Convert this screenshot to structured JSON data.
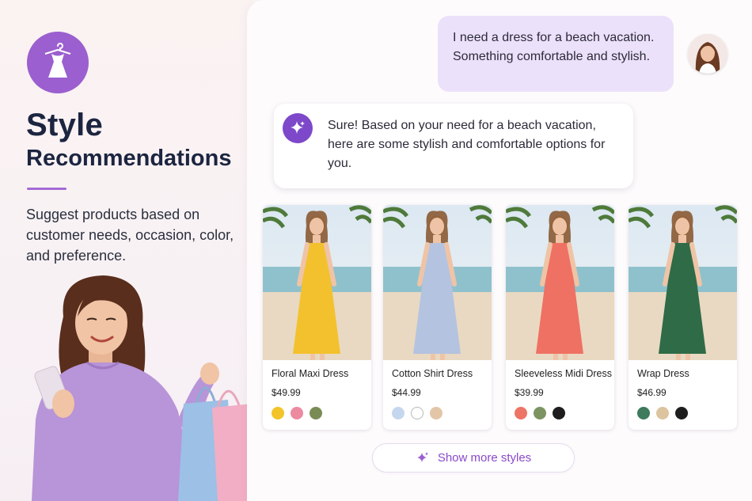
{
  "sidebar": {
    "logo_icon": "dress-hanger-icon",
    "title_line1": "Style",
    "title_line2": "Recommendations",
    "description": "Suggest products based on customer needs, occasion, color, and preference."
  },
  "chat": {
    "user_message": "I need a dress for a beach vacation. Something comfortable and stylish.",
    "assistant_icon": "sparkle-icon",
    "assistant_message": "Sure! Based on your need for a beach vacation, here are some stylish and comfortable options for you."
  },
  "products": [
    {
      "name": "Floral Maxi Dress",
      "price": "$49.99",
      "dress_color": "#f3c12e",
      "swatches": [
        "#f2c42a",
        "#ec8aa0",
        "#7a8c55"
      ]
    },
    {
      "name": "Cotton Shirt Dress",
      "price": "$44.99",
      "dress_color": "#b4c3e0",
      "swatches": [
        "#c5d7ee",
        "#ffffff",
        "#e3c6a7"
      ]
    },
    {
      "name": "Sleeveless Midi Dress",
      "price": "$39.99",
      "dress_color": "#ef7163",
      "swatches": [
        "#ee7466",
        "#7b9462",
        "#1e1e1e"
      ]
    },
    {
      "name": "Wrap Dress",
      "price": "$46.99",
      "dress_color": "#2f6b47",
      "swatches": [
        "#3e7a5c",
        "#dcc49f",
        "#1e1e1e"
      ]
    }
  ],
  "actions": {
    "show_more_label": "Show more styles",
    "show_more_icon": "sparkle-icon"
  },
  "colors": {
    "accent": "#8a49c9",
    "user_bubble": "#ece1fa",
    "logo_bg": "#9b5fcf"
  }
}
